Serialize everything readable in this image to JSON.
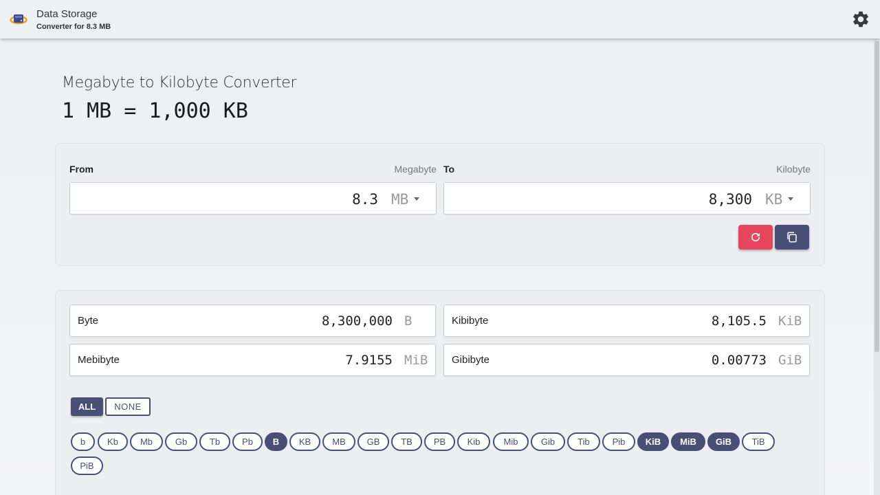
{
  "header": {
    "app_title": "Data Storage",
    "app_subtitle": "Converter for 8.3 MB",
    "logo_icon": "storage-drive-icon",
    "settings_icon": "gear-icon"
  },
  "main": {
    "title": "Megabyte to Kilobyte Converter",
    "formula": "1 MB = 1,000 KB"
  },
  "converter": {
    "from_label": "From",
    "from_unit_name": "Megabyte",
    "from_value": "8.3",
    "from_unit": "MB",
    "to_label": "To",
    "to_unit_name": "Kilobyte",
    "to_value": "8,300",
    "to_unit": "KB",
    "reset_icon": "refresh-icon",
    "copy_icon": "copy-icon",
    "reset_color": "#e8455f",
    "accent_color": "#474f77"
  },
  "results": [
    {
      "name": "Byte",
      "value": "8,300,000",
      "unit": "B"
    },
    {
      "name": "Kibibyte",
      "value": "8,105.5",
      "unit": "KiB"
    },
    {
      "name": "Mebibyte",
      "value": "7.9155",
      "unit": "MiB"
    },
    {
      "name": "Gibibyte",
      "value": "0.00773",
      "unit": "GiB"
    }
  ],
  "selection": {
    "all_label": "ALL",
    "none_label": "NONE"
  },
  "chips": [
    {
      "label": "b",
      "active": false
    },
    {
      "label": "Kb",
      "active": false
    },
    {
      "label": "Mb",
      "active": false
    },
    {
      "label": "Gb",
      "active": false
    },
    {
      "label": "Tb",
      "active": false
    },
    {
      "label": "Pb",
      "active": false
    },
    {
      "label": "B",
      "active": true
    },
    {
      "label": "KB",
      "active": false
    },
    {
      "label": "MB",
      "active": false
    },
    {
      "label": "GB",
      "active": false
    },
    {
      "label": "TB",
      "active": false
    },
    {
      "label": "PB",
      "active": false
    },
    {
      "label": "Kib",
      "active": false
    },
    {
      "label": "Mib",
      "active": false
    },
    {
      "label": "Gib",
      "active": false
    },
    {
      "label": "Tib",
      "active": false
    },
    {
      "label": "Pib",
      "active": false
    },
    {
      "label": "KiB",
      "active": true
    },
    {
      "label": "MiB",
      "active": true
    },
    {
      "label": "GiB",
      "active": true
    },
    {
      "label": "TiB",
      "active": false
    },
    {
      "label": "PiB",
      "active": false
    }
  ]
}
